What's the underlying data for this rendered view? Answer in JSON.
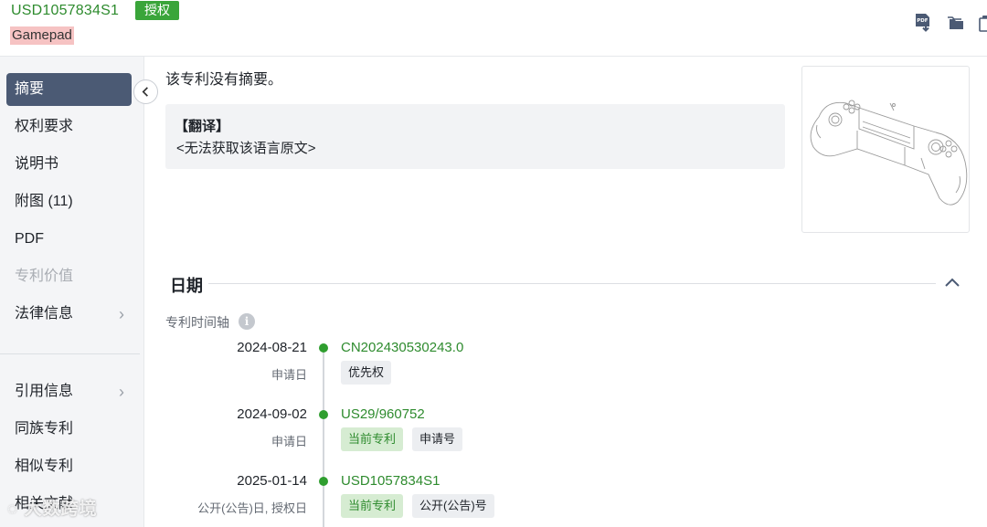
{
  "header": {
    "publication_number": "USD1057834S1",
    "status": "授权",
    "title": "Gamepad",
    "icons": [
      "pdf-download-icon",
      "folder-icon",
      "copy-icon"
    ]
  },
  "sidebar": {
    "items": [
      {
        "label": "摘要",
        "state": "active"
      },
      {
        "label": "权利要求"
      },
      {
        "label": "说明书"
      },
      {
        "label": "附图 (11)"
      },
      {
        "label": "PDF"
      },
      {
        "label": "专利价值",
        "state": "disabled"
      },
      {
        "label": "法律信息",
        "expandable": true
      },
      {
        "label": "引用信息",
        "expandable": true
      },
      {
        "label": "同族专利"
      },
      {
        "label": "相似专利"
      },
      {
        "label": "相关文献"
      }
    ]
  },
  "abstract": {
    "text": "该专利没有摘要。",
    "translation_title": "【翻译】",
    "translation_text": "<无法获取该语言原文>"
  },
  "dates": {
    "section_title": "日期",
    "timeline_label": "专利时间轴",
    "events": [
      {
        "date": "2024-08-21",
        "type": "申请日",
        "number": "CN202430530243.0",
        "tags": [
          "优先权"
        ]
      },
      {
        "date": "2024-09-02",
        "type": "申请日",
        "number": "US29/960752",
        "tags": [
          "当前专利",
          "申请号"
        ]
      },
      {
        "date": "2025-01-14",
        "type": "公开(公告)日, 授权日",
        "number": "USD1057834S1",
        "tags": [
          "当前专利",
          "公开(公告)号"
        ]
      }
    ]
  },
  "watermark": "大数跨境",
  "colors": {
    "accent": "#2e8b2e",
    "status_badge": "#3aa53a",
    "nav_active": "#4b5a74"
  }
}
